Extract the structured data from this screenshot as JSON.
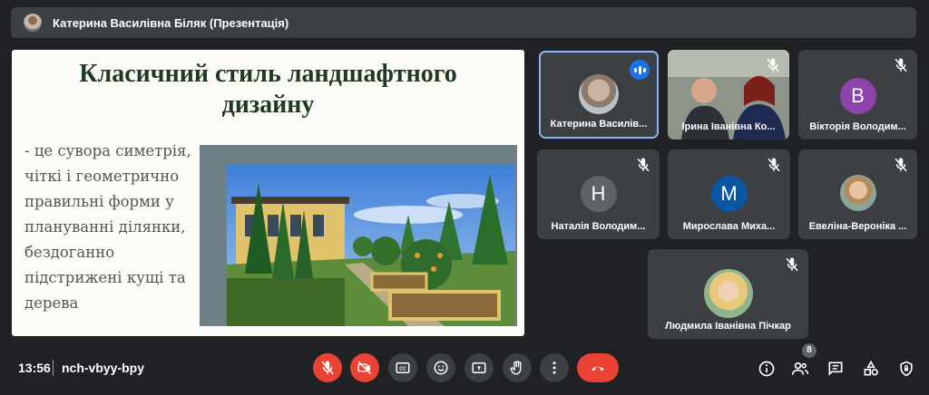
{
  "meeting": {
    "title": "Катерина Василівна Біляк (Презентація)",
    "time": "13:56",
    "code": "nch-vbyy-bpy"
  },
  "slide": {
    "title_line1": "Класичний стиль ландшафтного",
    "title_line2": "дизайну",
    "body": " - це сувора симетрія, чіткі і геометрично правильні форми у плануванні ділянки, бездоганно підстрижені кущі та дерева"
  },
  "participants": [
    {
      "name": "Катерина Василів...",
      "avatar": "photo",
      "speaking": true
    },
    {
      "name": "Ірина Іванівна Ко...",
      "avatar": "video",
      "muted": true
    },
    {
      "name": "Вікторія Володим...",
      "initial": "В",
      "color": "#8e44ad",
      "muted": true
    },
    {
      "name": "Наталія Володим...",
      "initial": "Н",
      "color": "#5f6368",
      "muted": true
    },
    {
      "name": "Мирослава Миха...",
      "initial": "М",
      "color": "#0b57a4",
      "muted": true
    },
    {
      "name": "Евеліна-Вероніка ...",
      "avatar": "photo",
      "muted": true
    },
    {
      "name": "Людмила Іванівна Пічкар",
      "avatar": "photo",
      "muted": true
    }
  ],
  "participant_count": "8",
  "colors": {
    "accent": "#1a73e8",
    "danger": "#ea4335",
    "tile": "#3c4043",
    "background": "#202124"
  },
  "icons": {
    "controls": [
      "mic-off-icon",
      "camera-off-icon",
      "captions-icon",
      "emoji-icon",
      "present-icon",
      "raise-hand-icon",
      "more-icon",
      "end-call-icon"
    ],
    "right": [
      "info-icon",
      "people-icon",
      "chat-icon",
      "activities-icon",
      "host-controls-icon"
    ]
  }
}
